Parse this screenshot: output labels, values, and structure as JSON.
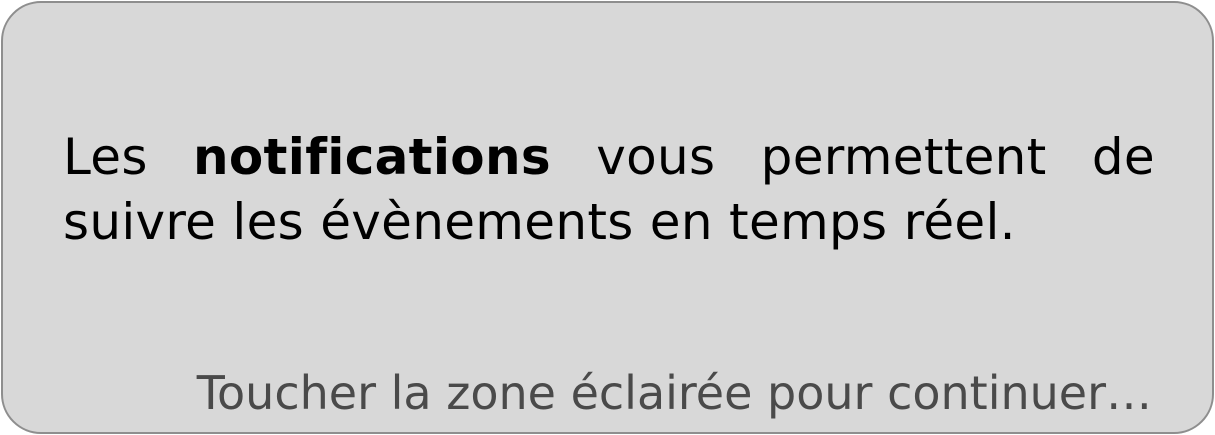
{
  "tooltip": {
    "message": {
      "before": "Les ",
      "emphasis": "notifications",
      "after": " vous permettent de suivre les évènements en temps réel."
    },
    "hint": "Toucher la zone éclairée pour continuer…"
  },
  "colors": {
    "card_background": "#d8d8d8",
    "card_border": "#8e8e8e",
    "message_text": "#000000",
    "hint_text": "#4a4a4a"
  }
}
